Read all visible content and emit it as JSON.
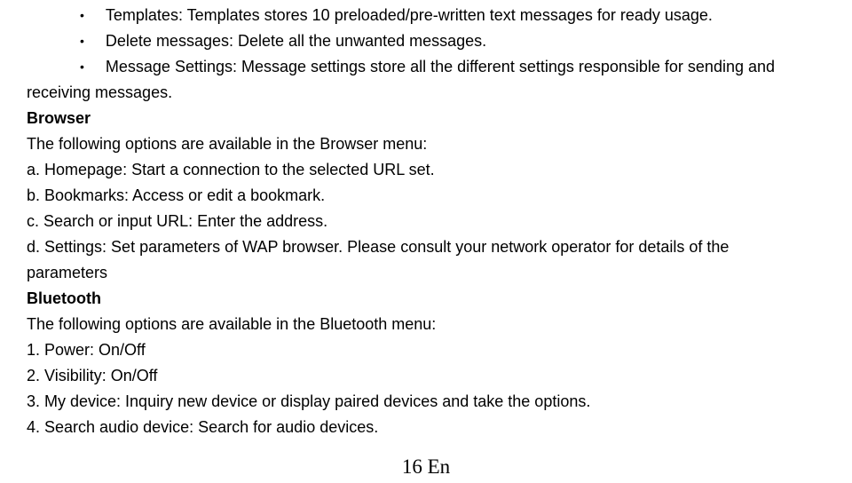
{
  "bullets": {
    "b1": "Templates: Templates stores 10 preloaded/pre-written text messages for ready usage.",
    "b2": "Delete messages: Delete all the unwanted messages.",
    "b3": "Message Settings: Message settings store all the different settings responsible for sending and"
  },
  "receiving_continuation": "receiving messages.",
  "browser": {
    "heading": "Browser",
    "intro": "The following options are available in the Browser menu:",
    "a": "a. Homepage: Start a connection to the selected URL set.",
    "b": "b. Bookmarks: Access or edit a bookmark.",
    "c": "c. Search or input URL: Enter the address.",
    "d": "d. Settings: Set parameters of WAP browser. Please consult your network operator for details of the"
  },
  "parameters_continuation": "parameters",
  "bluetooth": {
    "heading": "Bluetooth",
    "intro": "The following options are available in the Bluetooth menu:",
    "n1": "1. Power: On/Off",
    "n2": "2. Visibility: On/Off",
    "n3": "3. My device: Inquiry new device or display paired devices and take the options.",
    "n4": "4. Search audio device: Search for audio devices."
  },
  "page_footer": "16 En"
}
